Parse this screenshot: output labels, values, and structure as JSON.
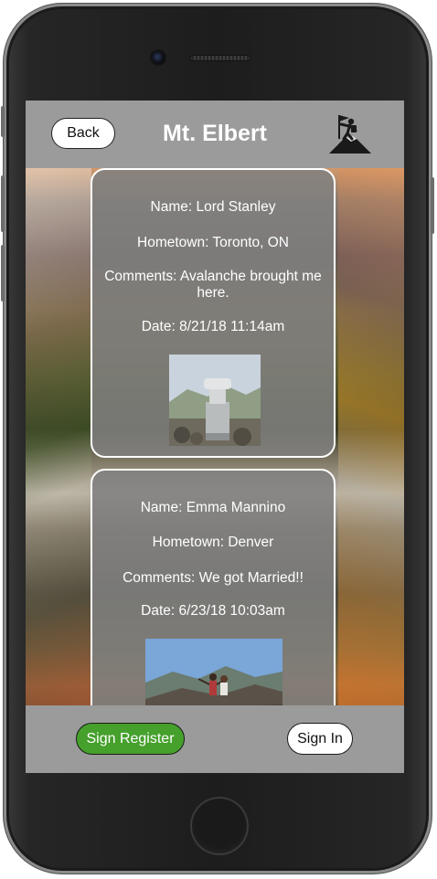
{
  "header": {
    "back_label": "Back",
    "title": "Mt. Elbert",
    "icon": "hiker-summit-icon"
  },
  "entries": [
    {
      "name": "Name: Lord Stanley",
      "hometown": "Hometown: Toronto, ON",
      "comments": "Comments: Avalanche brought me here.",
      "date": "Date: 8/21/18 11:14am",
      "photo": "stanley-cup-photo"
    },
    {
      "name": "Name: Emma Mannino",
      "hometown": "Hometown: Denver",
      "comments": "Comments: We got Married!!",
      "date": "Date: 6/23/18 10:03am",
      "photo": "summit-couple-photo"
    }
  ],
  "footer": {
    "register_label": "Sign Register",
    "signin_label": "Sign In"
  },
  "colors": {
    "bar_gray": "#9b9b9b",
    "card_gray": "#808080",
    "register_green": "#45a02c"
  }
}
